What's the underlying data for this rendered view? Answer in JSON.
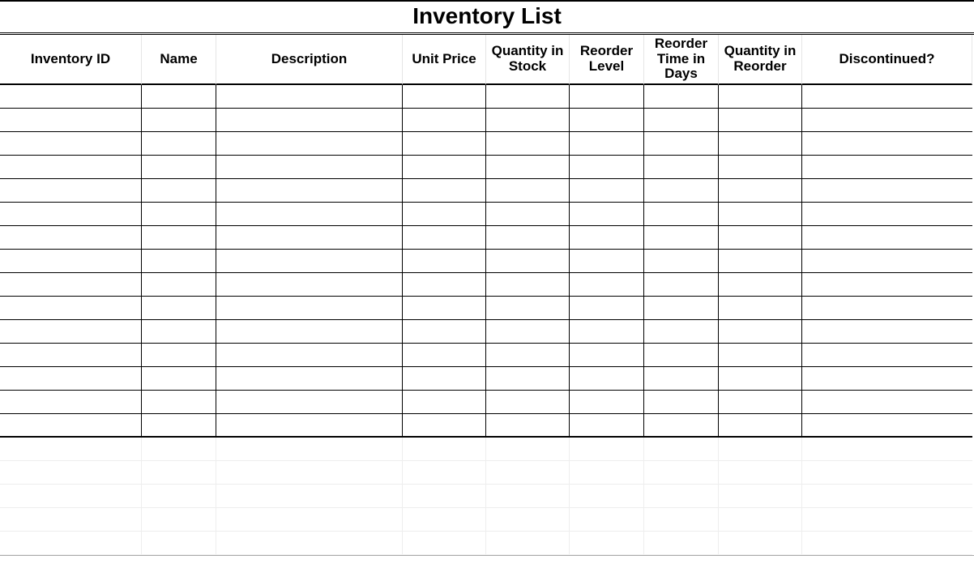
{
  "title": "Inventory List",
  "columns": [
    "Inventory ID",
    "Name",
    "Description",
    "Unit Price",
    "Quantity in Stock",
    "Reorder Level",
    "Reorder Time in Days",
    "Quantity in Reorder",
    "Discontinued?"
  ],
  "rows": [
    [
      "",
      "",
      "",
      "",
      "",
      "",
      "",
      "",
      ""
    ],
    [
      "",
      "",
      "",
      "",
      "",
      "",
      "",
      "",
      ""
    ],
    [
      "",
      "",
      "",
      "",
      "",
      "",
      "",
      "",
      ""
    ],
    [
      "",
      "",
      "",
      "",
      "",
      "",
      "",
      "",
      ""
    ],
    [
      "",
      "",
      "",
      "",
      "",
      "",
      "",
      "",
      ""
    ],
    [
      "",
      "",
      "",
      "",
      "",
      "",
      "",
      "",
      ""
    ],
    [
      "",
      "",
      "",
      "",
      "",
      "",
      "",
      "",
      ""
    ],
    [
      "",
      "",
      "",
      "",
      "",
      "",
      "",
      "",
      ""
    ],
    [
      "",
      "",
      "",
      "",
      "",
      "",
      "",
      "",
      ""
    ],
    [
      "",
      "",
      "",
      "",
      "",
      "",
      "",
      "",
      ""
    ],
    [
      "",
      "",
      "",
      "",
      "",
      "",
      "",
      "",
      ""
    ],
    [
      "",
      "",
      "",
      "",
      "",
      "",
      "",
      "",
      ""
    ],
    [
      "",
      "",
      "",
      "",
      "",
      "",
      "",
      "",
      ""
    ],
    [
      "",
      "",
      "",
      "",
      "",
      "",
      "",
      "",
      ""
    ],
    [
      "",
      "",
      "",
      "",
      "",
      "",
      "",
      "",
      ""
    ]
  ],
  "ghost_rows": 5
}
